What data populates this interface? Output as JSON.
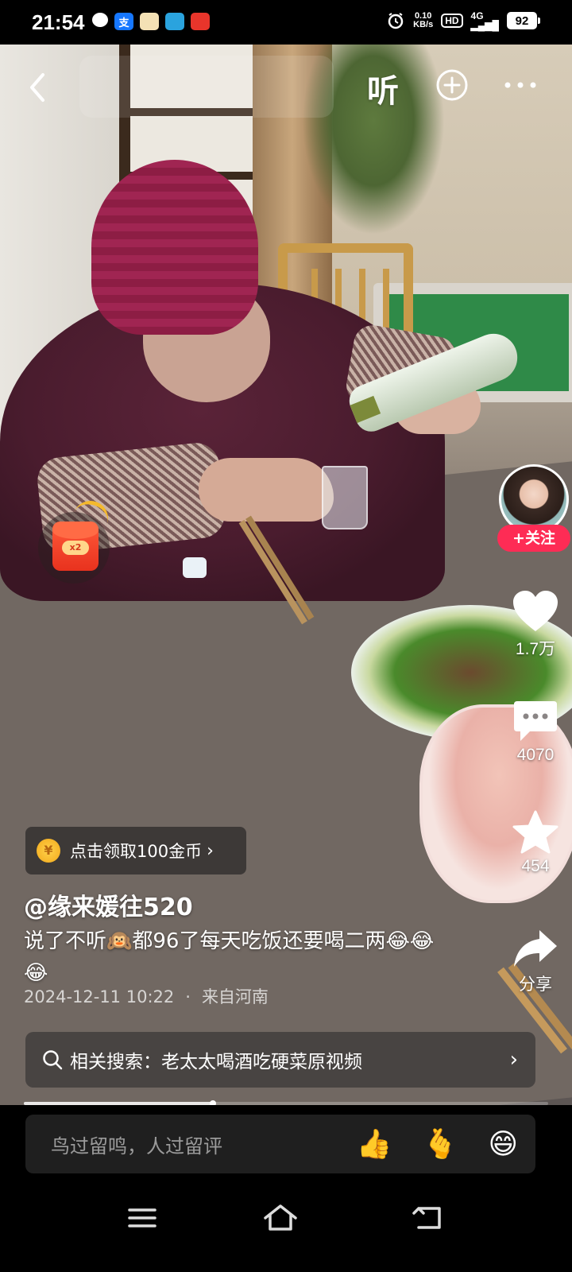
{
  "status_bar": {
    "time": "21:54",
    "net_speed_value": "0.10",
    "net_speed_unit": "KB/s",
    "hd": "HD",
    "network": "4G",
    "battery": "92",
    "notification_icons": [
      "chat-bubble-icon",
      "alipay-icon",
      "app-icon",
      "telegram-icon",
      "news-app-icon"
    ]
  },
  "top_bar": {
    "listen_label": "听",
    "icons": [
      "back-arrow-icon",
      "add-circle-icon",
      "more-dots-icon"
    ]
  },
  "red_packet": {
    "badge": "x2"
  },
  "sidebar": {
    "follow_label": "+关注",
    "like_count": "1.7万",
    "comment_count": "4070",
    "favorite_count": "454",
    "share_label": "分享"
  },
  "coin_task": {
    "coin_symbol": "¥",
    "label": "点击领取100金币",
    "chevron": "›"
  },
  "post": {
    "author": "@缘来媛往520",
    "caption": "说了不听🙉都96了每天吃饭还要喝二两😂😂😂",
    "date": "2024-12-11 10:22",
    "separator": "·",
    "location": "来自河南"
  },
  "related_search": {
    "text": "相关搜索：老太太喝酒吃硬菜原视频",
    "chevron": "›"
  },
  "playback": {
    "progress_fraction": 0.36
  },
  "comment_bar": {
    "placeholder": "鸟过留鸣，人过留评",
    "emojis": [
      "👍",
      "🫰",
      "😄"
    ]
  },
  "nav_bar": {
    "icons": [
      "menu-icon",
      "home-icon",
      "back-icon"
    ]
  },
  "colors": {
    "follow_red": "#fe2c55",
    "coin_gold": "#f2a81b",
    "background": "#000000"
  }
}
